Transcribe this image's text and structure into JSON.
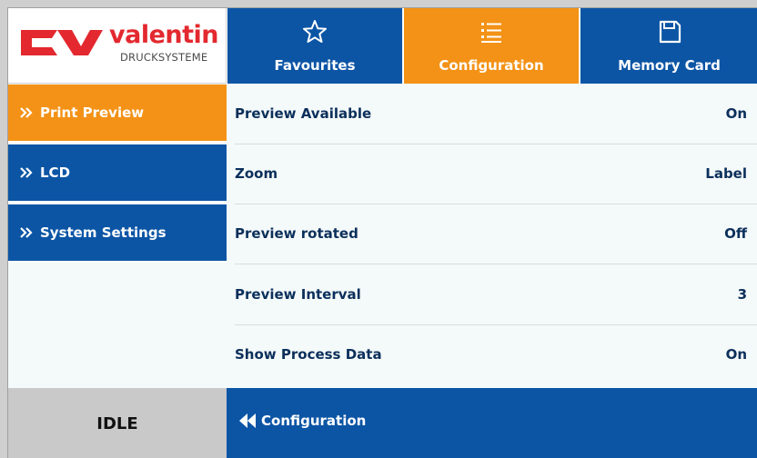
{
  "logo": {
    "word": "valentin",
    "sub": "DRUCKSYSTEME"
  },
  "tabs": [
    {
      "label": "Favourites",
      "icon": "star-icon",
      "active": false
    },
    {
      "label": "Configuration",
      "icon": "list-icon",
      "active": true
    },
    {
      "label": "Memory Card",
      "icon": "floppy-disk-icon",
      "active": false
    }
  ],
  "sidebar": {
    "items": [
      {
        "label": "Print Preview",
        "active": true
      },
      {
        "label": "LCD",
        "active": false
      },
      {
        "label": "System Settings",
        "active": false
      }
    ]
  },
  "settings": {
    "rows": [
      {
        "label": "Preview Available",
        "value": "On"
      },
      {
        "label": "Zoom",
        "value": "Label"
      },
      {
        "label": "Preview rotated",
        "value": "Off"
      },
      {
        "label": "Preview Interval",
        "value": "3"
      },
      {
        "label": "Show Process Data",
        "value": "On"
      }
    ]
  },
  "footer": {
    "status": "IDLE",
    "back_label": "Configuration"
  },
  "colors": {
    "blue": "#0c55a5",
    "orange": "#f39216",
    "text_dark": "#0b2f5b",
    "logo_red": "#e3282f"
  }
}
